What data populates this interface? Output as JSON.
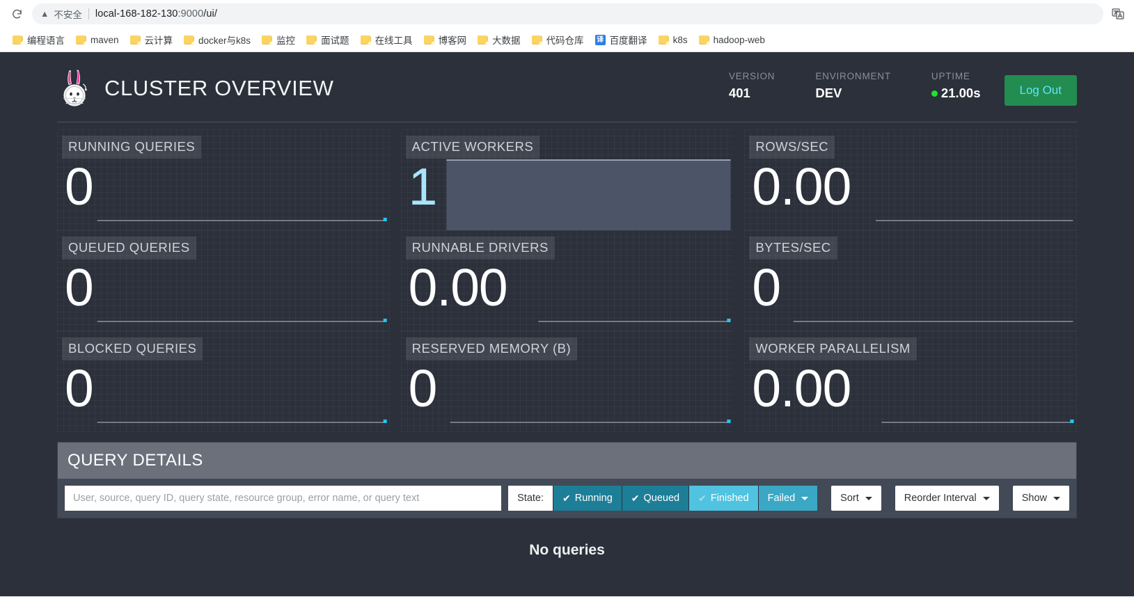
{
  "browser": {
    "reload_icon": "reload-icon",
    "security_icon": "warning-triangle-icon",
    "security_label": "不安全",
    "url_host": "local-168-182-130",
    "url_port": ":9000",
    "url_path": "/ui/",
    "translate_icon": "translate-icon",
    "bookmarks": [
      {
        "label": "编程语言",
        "icon": "folder-icon"
      },
      {
        "label": "maven",
        "icon": "folder-icon"
      },
      {
        "label": "云计算",
        "icon": "folder-icon"
      },
      {
        "label": "docker与k8s",
        "icon": "folder-icon"
      },
      {
        "label": "监控",
        "icon": "folder-icon"
      },
      {
        "label": "面试题",
        "icon": "folder-icon"
      },
      {
        "label": "在线工具",
        "icon": "folder-icon"
      },
      {
        "label": "博客网",
        "icon": "folder-icon"
      },
      {
        "label": "大数据",
        "icon": "folder-icon"
      },
      {
        "label": "代码仓库",
        "icon": "folder-icon"
      },
      {
        "label": "百度翻译",
        "icon": "translate-favicon",
        "favicon_text": "译"
      },
      {
        "label": "k8s",
        "icon": "folder-icon"
      },
      {
        "label": "hadoop-web",
        "icon": "folder-icon"
      }
    ]
  },
  "header": {
    "logo_icon": "rabbit-astronaut-logo",
    "title": "CLUSTER OVERVIEW",
    "stats": [
      {
        "label": "VERSION",
        "value": "401"
      },
      {
        "label": "ENVIRONMENT",
        "value": "DEV"
      },
      {
        "label": "UPTIME",
        "value": "21.00s",
        "has_dot": true
      }
    ],
    "logout_label": "Log Out",
    "logout_bg": "#238c50",
    "logout_color": "#5fe6ff",
    "status_dot_color": "#19e52a"
  },
  "stats": [
    {
      "label": "RUNNING QUERIES",
      "value": "0",
      "accent": false,
      "spark": "line-flat"
    },
    {
      "label": "ACTIVE WORKERS",
      "value": "1",
      "accent": true,
      "spark": "area-full"
    },
    {
      "label": "ROWS/SEC",
      "value": "0.00",
      "accent": false,
      "spark": "line-flat"
    },
    {
      "label": "QUEUED QUERIES",
      "value": "0",
      "accent": false,
      "spark": "line-flat"
    },
    {
      "label": "RUNNABLE DRIVERS",
      "value": "0.00",
      "accent": false,
      "spark": "line-flat"
    },
    {
      "label": "BYTES/SEC",
      "value": "0",
      "accent": false,
      "spark": "line-flat"
    },
    {
      "label": "BLOCKED QUERIES",
      "value": "0",
      "accent": false,
      "spark": "line-flat"
    },
    {
      "label": "RESERVED MEMORY (B)",
      "value": "0",
      "accent": false,
      "spark": "line-flat"
    },
    {
      "label": "WORKER PARALLELISM",
      "value": "0.00",
      "accent": false,
      "spark": "line-flat"
    }
  ],
  "query_details": {
    "title": "QUERY DETAILS",
    "search_placeholder": "User, source, query ID, query state, resource group, error name, or query text",
    "search_value": "",
    "state_label": "State:",
    "state_filters": [
      {
        "label": "Running",
        "checked": true,
        "active": true,
        "style": "teal"
      },
      {
        "label": "Queued",
        "checked": true,
        "active": true,
        "style": "teal"
      },
      {
        "label": "Finished",
        "checked": true,
        "active": false,
        "style": "teal-light"
      },
      {
        "label": "Failed",
        "checked": false,
        "active": false,
        "style": "teal-mid",
        "caret": true
      }
    ],
    "sort_label": "Sort",
    "reorder_label": "Reorder Interval",
    "show_label": "Show",
    "empty_message": "No queries",
    "accent_teal": "#1d7e97",
    "accent_teal_light": "#4fc3e0"
  }
}
